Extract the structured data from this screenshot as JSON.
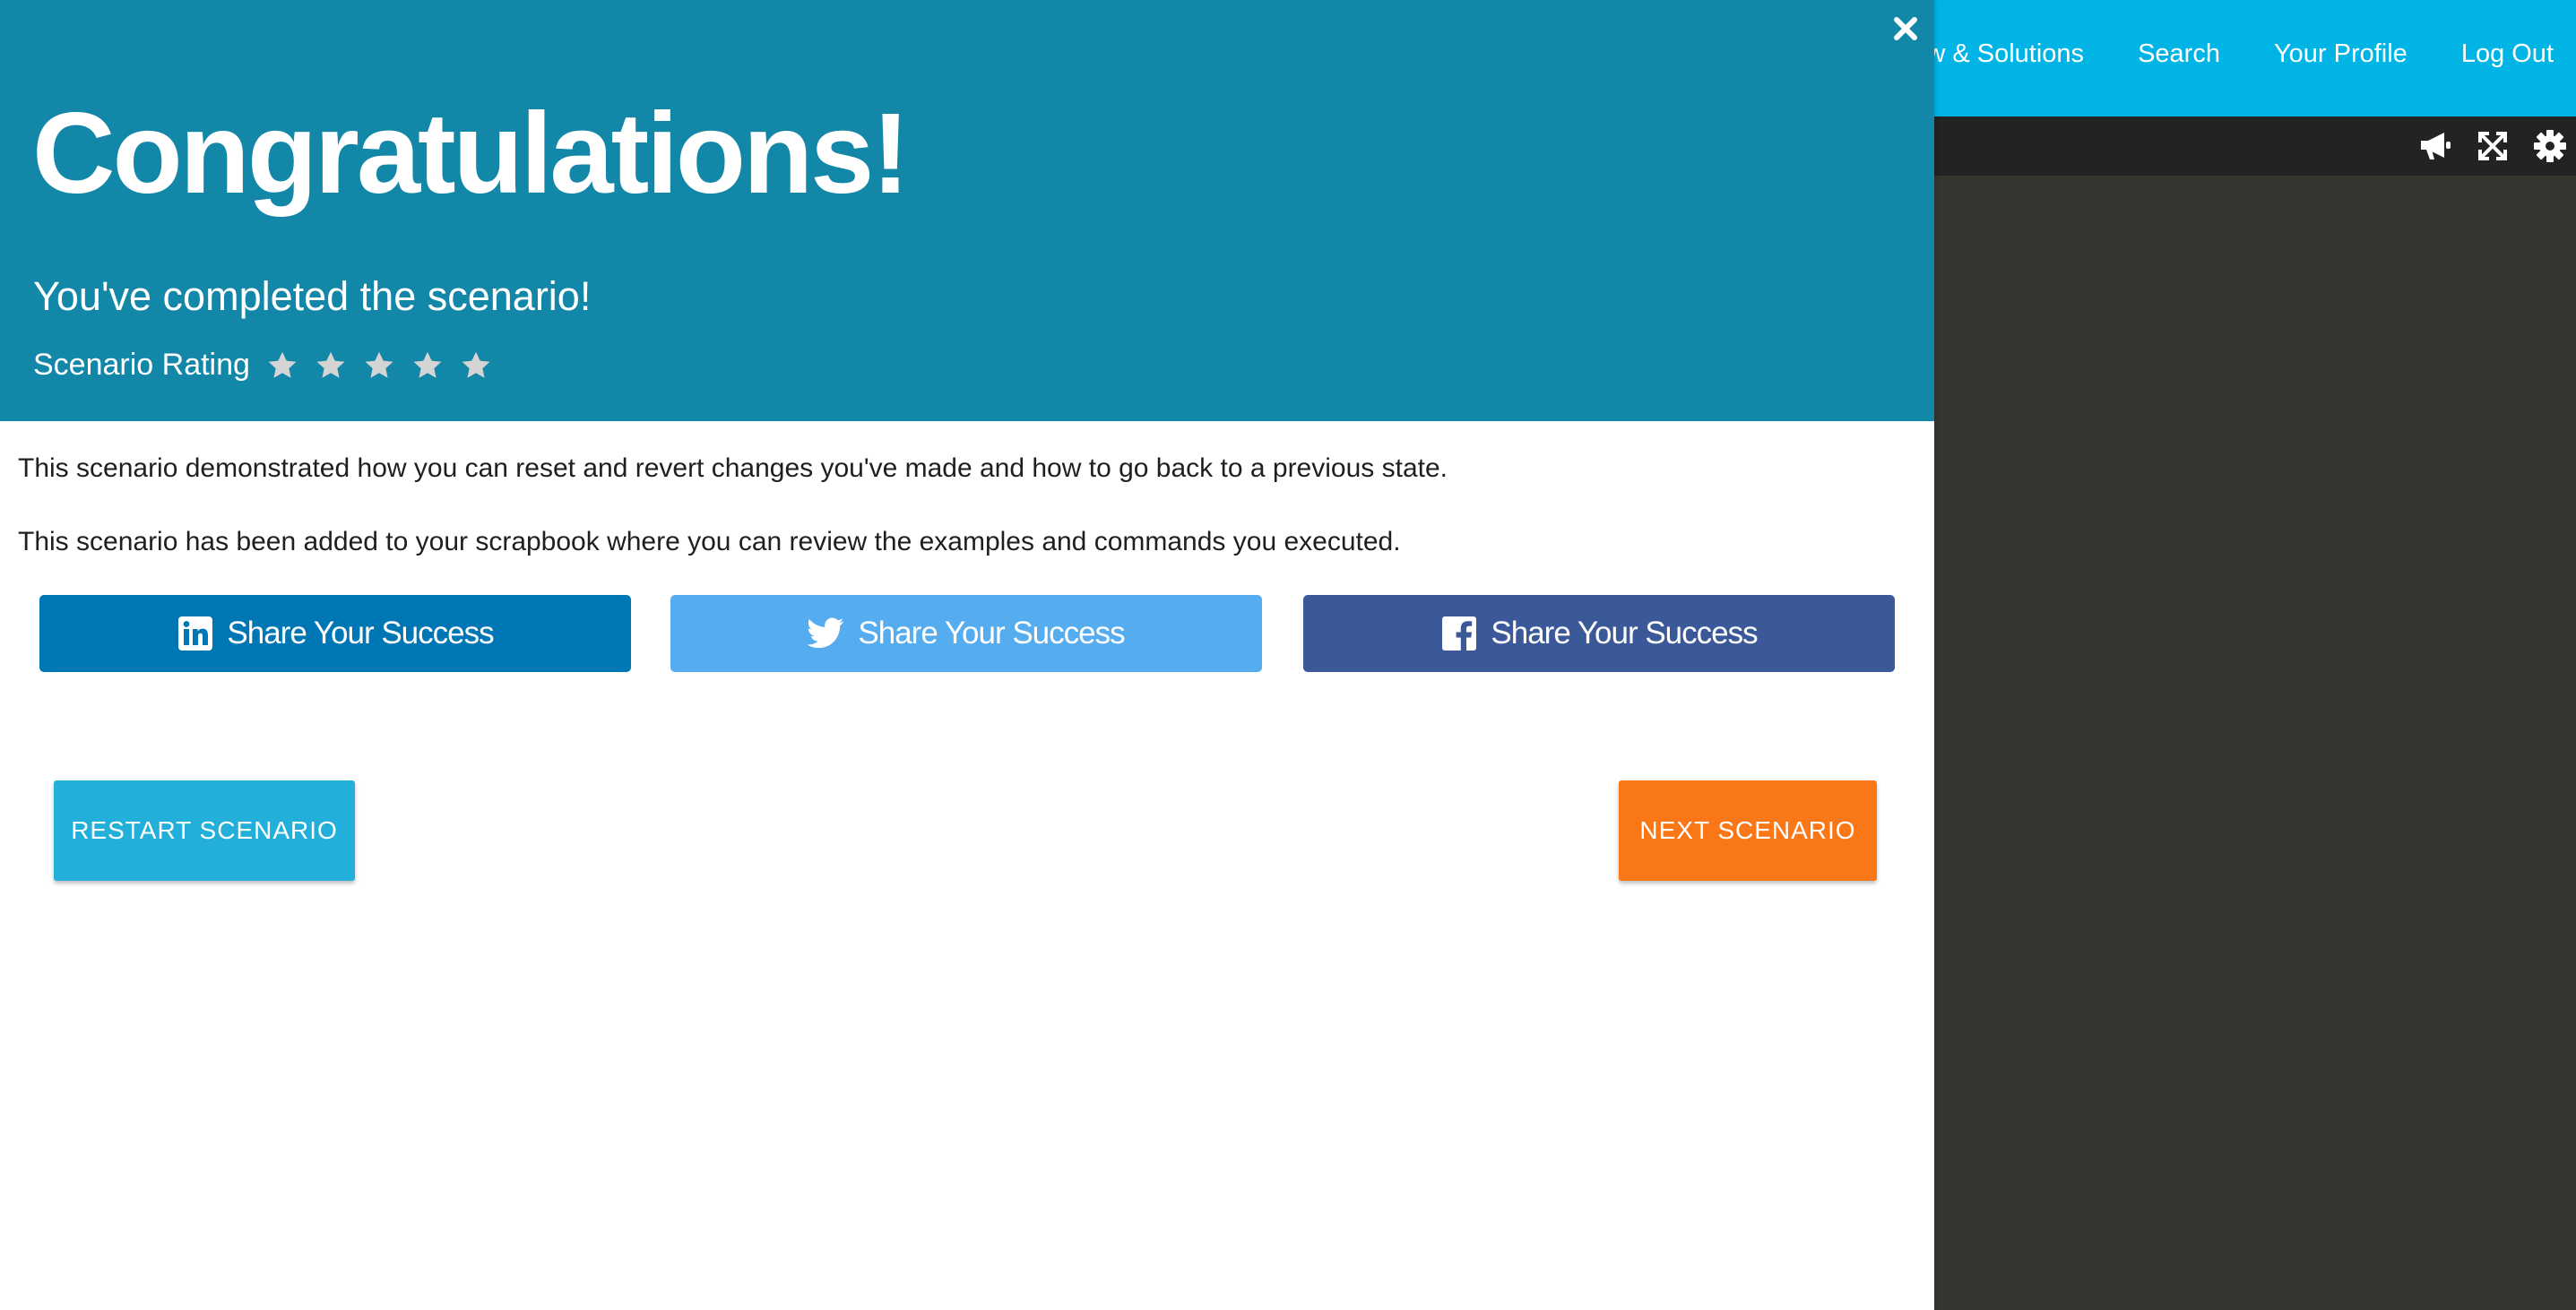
{
  "nav": {
    "links": [
      "ew & Solutions",
      "Search",
      "Your Profile",
      "Log Out"
    ]
  },
  "toolbar": {
    "icons": [
      "megaphone-icon",
      "expand-icon",
      "gear-icon"
    ]
  },
  "modal": {
    "title": "Congratulations!",
    "subtitle": "You've completed the scenario!",
    "rating_label": "Scenario Rating",
    "rating_max": 5,
    "body_line_1": "This scenario demonstrated how you can reset and revert changes you've made and how to go back to a previous state.",
    "body_line_2": "This scenario has been added to your scrapbook where you can review the examples and commands you executed.",
    "share": {
      "linkedin_label": "Share Your Success",
      "twitter_label": "Share Your Success",
      "facebook_label": "Share Your Success"
    },
    "restart_label": "RESTART SCENARIO",
    "next_label": "NEXT SCENARIO"
  },
  "colors": {
    "header_bg": "#1387a8",
    "nav_bg": "#00b5e6",
    "linkedin": "#0077b5",
    "twitter": "#55acee",
    "facebook": "#3b5998",
    "restart": "#22b0da",
    "next": "#fa7718",
    "terminal_bg": "#36352f",
    "toolbar_bg": "#232323"
  }
}
